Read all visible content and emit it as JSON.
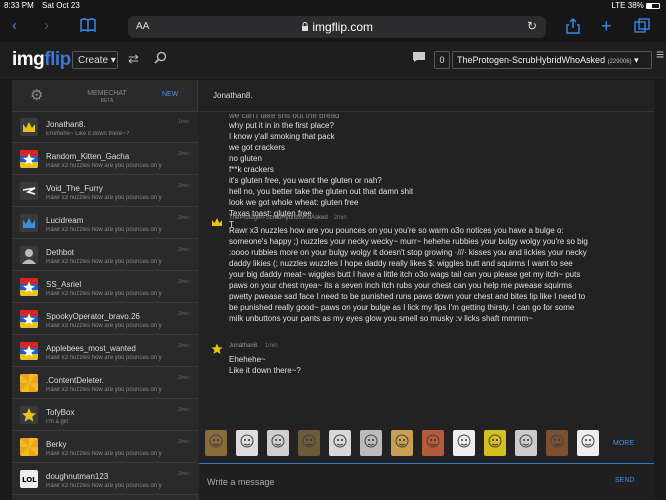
{
  "status_bar": {
    "time": "8:33 PM",
    "date": "Sat Oct 23",
    "signal": "LTE",
    "battery": "38%"
  },
  "browser": {
    "text_size": "AA",
    "url": "imgflip.com",
    "reload_icon": "reload-icon"
  },
  "site": {
    "logo_img": "img",
    "logo_flip": "flip",
    "create_label": "Create ▾",
    "notif_count": "0",
    "username": "TheProtogen-ScrubHybridWhoAsked",
    "user_points": "(229006)"
  },
  "sidebar": {
    "title": "MEMECHAT",
    "beta": "BETA",
    "new_label": "NEW",
    "conversations": [
      {
        "name": "Jonathan8.",
        "preview": "Ehehehe~ Like it down there~?",
        "time": "1min",
        "avatar": "crown"
      },
      {
        "name": "Random_Kitten_Gacha",
        "preview": "Rawr x3 nuzzles how are you pounces on y",
        "time": "2min",
        "avatar": "flag"
      },
      {
        "name": "Void_The_Furry",
        "preview": "Rawr x3 nuzzles how are you pounces on y",
        "time": "2min",
        "avatar": "bolt"
      },
      {
        "name": "Lucidream",
        "preview": "Rawr x3 nuzzles how are you pounces on y",
        "time": "2min",
        "avatar": "crown-blue"
      },
      {
        "name": "Dethbot",
        "preview": "Rawr x3 nuzzles how are you pounces on y",
        "time": "2min",
        "avatar": "person"
      },
      {
        "name": "SS_Asriel",
        "preview": "Rawr x3 nuzzles how are you pounces on y",
        "time": "2min",
        "avatar": "flag"
      },
      {
        "name": "SpookyOperator_bravo.26",
        "preview": "Rawr x3 nuzzles how are you pounces on y",
        "time": "2min",
        "avatar": "flag"
      },
      {
        "name": "Applebees_most_wanted",
        "preview": "Rawr x3 nuzzles how are you pounces on y",
        "time": "2min",
        "avatar": "flag"
      },
      {
        "name": ".ContentDeleter.",
        "preview": "Rawr x3 nuzzles how are you pounces on y",
        "time": "2min",
        "avatar": "pinwheel"
      },
      {
        "name": "TofyBox",
        "preview": "I'm a girl",
        "time": "2min",
        "avatar": "star"
      },
      {
        "name": "Berky",
        "preview": "Rawr x3 nuzzles how are you pounces on y",
        "time": "2min",
        "avatar": "pinwheel"
      },
      {
        "name": "doughnutman123",
        "preview": "Rawr x3 nuzzles how are you pounces on y",
        "time": "2min",
        "avatar": "lol"
      }
    ]
  },
  "main": {
    "contact": "Jonathan8.",
    "message1_lines": [
      "we can't take shit out the bread",
      "why put it in in the first place?",
      "I know y'all smoking that pack",
      "we got crackers",
      "no gluten",
      "f**k crackers",
      "it's gluten free, you want the gluten or nah?",
      "hell no, you better take the gluten out that damn shit",
      "look we got whole wheat: gluten free",
      "Texas toast: gluten free",
      "T"
    ],
    "message2": {
      "author": "TheProtogen-ScrubHybridWhoAsked",
      "time": "2min",
      "lines": [
        "Rawr x3 nuzzles how are you pounces on you you're so warm o3o notices you have a bulge o:",
        "someone's happy ;) nuzzles your necky wecky~ murr~ hehehe rubbies your bulgy wolgy you're so big",
        ":oooo rubbies more on your bulgy wolgy it doesn't stop growing ·///· kisses you and lickies your necky",
        "daddy likies (; nuzzles wuzzles I hope daddy really likes $: wiggles butt and squirms I want to see",
        "your big daddy meat~ wiggles butt I have a little itch o3o wags tail can you please get my itch~ puts",
        "paws on your chest nyea~ its a seven inch itch rubs your chest can you help me pwease squirms",
        "pwetty pwease sad face I need to be punished runs paws down your chest and bites lip like I need to",
        "be punished really good~ paws on your bulge as I lick my lips I'm getting thirsty. I can go for some",
        "milk unbuttons your pants as my eyes glow you smell so musky :v licks shaft mmmm~"
      ]
    },
    "message3": {
      "author": "Jonathan8.",
      "time": "1min",
      "lines": [
        "Ehehehe~",
        "Like it down there~?"
      ]
    },
    "meme_count": 13,
    "more_label": "MORE",
    "composer_placeholder": "Write a message",
    "send_label": "SEND"
  },
  "colors": {
    "accent": "#4a8fe0",
    "safari_blue": "#3a8cf5",
    "brand": "#3a78d8"
  }
}
